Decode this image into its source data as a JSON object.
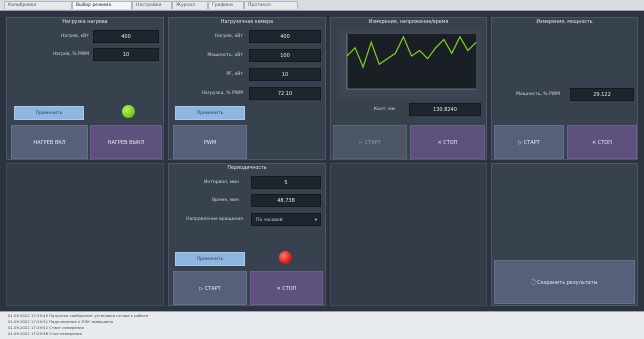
{
  "tabs": [
    "Калибровка",
    "Выбор режима",
    "Настройки",
    "Журнал",
    "Графики",
    "Протокол"
  ],
  "panel_heater": {
    "title": "Нагрузка нагрева",
    "rows": [
      {
        "label": "Нагрев, кВт",
        "value": "400"
      },
      {
        "label": "Нагрев, % PWM",
        "value": "10"
      }
    ],
    "apply_label": "Применить",
    "on_label": "НАГРЕВ ВКЛ",
    "off_label": "НАГРЕВ ВЫКЛ"
  },
  "panel_load": {
    "title": "Нагрузочная камера",
    "rows": [
      {
        "label": "Нагрев, кВт",
        "value": "400"
      },
      {
        "label": "Мощность, кВт",
        "value": "100"
      },
      {
        "label": "PF, кВт",
        "value": "10"
      },
      {
        "label": "Нагрузка, % PWM",
        "value": "72.10"
      }
    ],
    "apply_label": "Применить",
    "btn_label": "PWM"
  },
  "panel_chart": {
    "title": "Измерения, напряжение/время",
    "value_label": "Конт. мм",
    "value": "130.8240",
    "start_label": "СТАРТ",
    "stop_label": "СТОП"
  },
  "panel_measure": {
    "title": "Измерения, мощность",
    "value_label": "Мощность, % PWM",
    "value": "29.122",
    "start_label": "СТАРТ",
    "stop_label": "СТОП"
  },
  "panel_cycle": {
    "title": "Периодичность",
    "rows": [
      {
        "label": "Интервал, мин",
        "value": "5"
      },
      {
        "label": "Время, мин",
        "value": "48.738"
      }
    ],
    "select_label": "Направление вращения",
    "select_value": "По часовой",
    "apply_label": "Применить",
    "start_label": "СТАРТ",
    "stop_label": "СТОП"
  },
  "save_label": "Сохранить результаты",
  "log_lines": [
    "01.09.2022 17:29:45 Получено сообщение: установка готова к работе",
    "01.09.2022 17:29:51 Подключение к ПЛК завершено",
    "01.09.2022 17:29:52 Старт измерения",
    "01.09.2022 17:29:58 Стоп измерения"
  ],
  "indicators": {
    "heater": "#7ed321",
    "cycle": "#e0261d"
  },
  "chart_data": {
    "type": "line",
    "x": [
      0,
      2,
      4,
      6,
      8,
      10,
      12,
      14,
      16,
      18,
      20,
      22,
      24,
      26,
      28,
      30,
      32
    ],
    "series": [
      {
        "values": [
          60,
          75,
          40,
          85,
          45,
          55,
          65,
          95,
          60,
          70,
          55,
          75,
          90,
          65,
          95,
          70,
          85
        ]
      }
    ],
    "xlim": [
      0,
      32
    ],
    "ylim": [
      0,
      100
    ],
    "color": "#7ed321",
    "grid": false
  }
}
